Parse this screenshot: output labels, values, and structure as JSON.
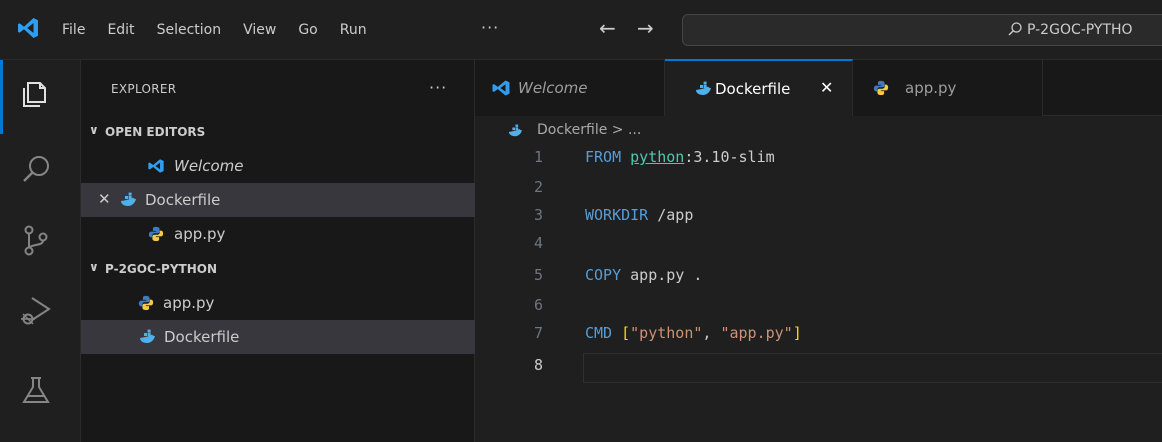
{
  "colors": {
    "accent": "#0078d4",
    "docker": "#4fb0ea",
    "python_blue": "#3e7bc1",
    "python_yellow": "#f7c948"
  },
  "titlebar": {
    "menu": [
      "File",
      "Edit",
      "Selection",
      "View",
      "Go",
      "Run"
    ],
    "more": "···",
    "back": "←",
    "forward": "→",
    "search_text": "P-2GOC-PYTHO"
  },
  "activity_bar": {
    "icons": [
      "explorer-icon",
      "search-icon",
      "source-control-icon",
      "run-debug-icon",
      "testing-icon"
    ]
  },
  "sidebar": {
    "title": "EXPLORER",
    "more": "···",
    "open_editors": {
      "label": "OPEN EDITORS",
      "chevron": "∨",
      "items": [
        {
          "label": "Welcome",
          "icon": "vscode-icon"
        },
        {
          "label": "Dockerfile",
          "icon": "docker-icon",
          "close": "✕"
        },
        {
          "label": "app.py",
          "icon": "python-icon"
        }
      ]
    },
    "folder": {
      "label": "P-2GOC-PYTHON",
      "chevron": "∨",
      "items": [
        {
          "label": "app.py",
          "icon": "python-icon"
        },
        {
          "label": "Dockerfile",
          "icon": "docker-icon"
        }
      ]
    }
  },
  "editor": {
    "tabs": [
      {
        "label": "Welcome",
        "icon": "vscode-icon"
      },
      {
        "label": "Dockerfile",
        "icon": "docker-icon",
        "close": "✕"
      },
      {
        "label": "app.py",
        "icon": "python-icon"
      }
    ],
    "breadcrumb": "Dockerfile > ...",
    "line_numbers": [
      "1",
      "2",
      "3",
      "4",
      "5",
      "6",
      "7",
      "8"
    ],
    "code": {
      "l1_kw": "FROM",
      "l1_image": "python",
      "l1_tag": ":3.10-slim",
      "l3_kw": "WORKDIR",
      "l3_arg": " /app",
      "l5_kw": "COPY",
      "l5_arg": " app.py .",
      "l7_kw": "CMD",
      "l7_open": " [",
      "l7_s1": "\"python\"",
      "l7_sep": ", ",
      "l7_s2": "\"app.py\"",
      "l7_close": "]"
    }
  }
}
